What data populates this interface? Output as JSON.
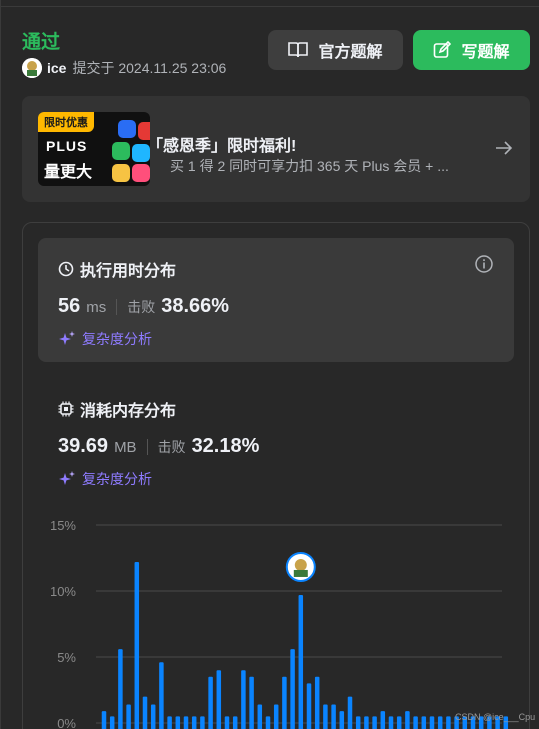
{
  "status": "通过",
  "submitter": {
    "name": "ice",
    "submitted_label": "提交于 2024.11.25 23:06"
  },
  "buttons": {
    "official_solution": "官方题解",
    "write_solution": "写题解"
  },
  "promo": {
    "tag": "限时优惠",
    "plus_text": "PLUS",
    "slogan": "量更大",
    "title": "「感恩季」限时福利!",
    "description": "买 1 得 2 同时可享力扣 365 天 Plus 会员 + ..."
  },
  "runtime": {
    "title": "执行用时分布",
    "value": "56",
    "unit": "ms",
    "beat_label": "击败",
    "beat_pct": "38.66%",
    "analysis": "复杂度分析"
  },
  "memory": {
    "title": "消耗内存分布",
    "value": "39.69",
    "unit": "MB",
    "beat_label": "击败",
    "beat_pct": "32.18%",
    "analysis": "复杂度分析"
  },
  "watermark": "CSDN @ice___Cpu",
  "colors": {
    "accent_green": "#2cbb5d",
    "bar_blue": "#0a84ff",
    "analysis_purple": "#8e7bff"
  },
  "chart_data": {
    "type": "bar",
    "y_ticks": [
      "15%",
      "10%",
      "5%",
      "0%"
    ],
    "ylim": [
      0,
      15
    ],
    "grid": true,
    "highlight_index": 24,
    "values": [
      0.9,
      0.5,
      5.6,
      1.4,
      12.2,
      2.0,
      1.4,
      4.6,
      0.5,
      0.5,
      0.5,
      0.5,
      0.5,
      3.5,
      4.0,
      0.5,
      0.5,
      4.0,
      3.5,
      1.4,
      0.5,
      1.4,
      3.5,
      5.6,
      9.7,
      3.0,
      3.5,
      1.4,
      1.4,
      0.9,
      2.0,
      0.5,
      0.5,
      0.5,
      0.9,
      0.5,
      0.5,
      0.9,
      0.5,
      0.5,
      0.5,
      0.5,
      0.5,
      0.5,
      0.5,
      0.5,
      0.5,
      0.5,
      0.5,
      0.5
    ]
  }
}
